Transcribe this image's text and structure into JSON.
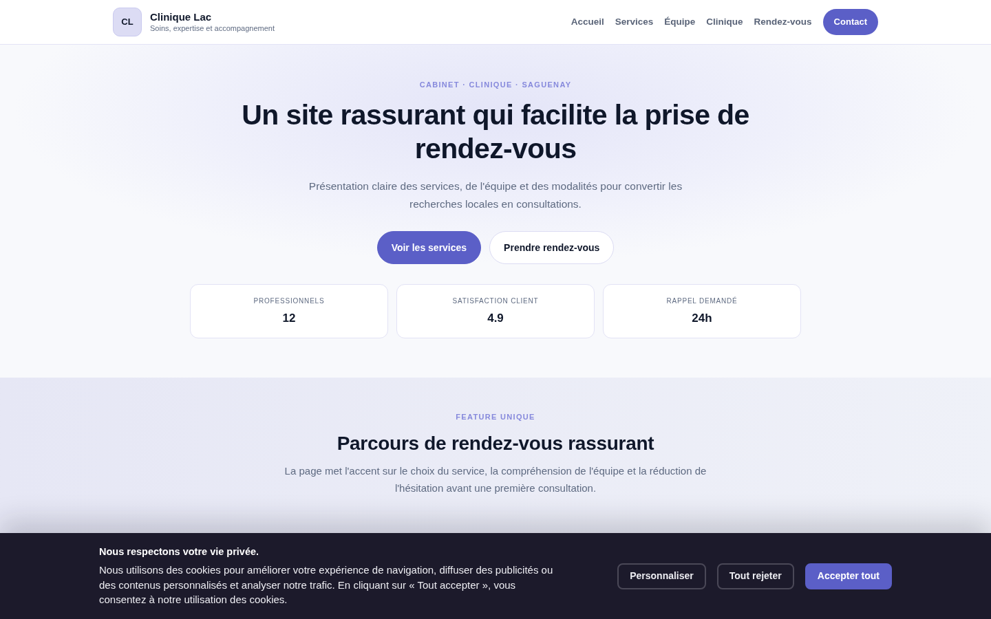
{
  "header": {
    "logo": "CL",
    "brand": "Clinique Lac",
    "tagline": "Soins, expertise et accompagnement",
    "nav": [
      "Accueil",
      "Services",
      "Équipe",
      "Clinique",
      "Rendez-vous"
    ],
    "cta": "Contact"
  },
  "hero": {
    "eyebrow": "CABINET · CLINIQUE · SAGUENAY",
    "title": "Un site rassurant qui facilite la prise de rendez-vous",
    "text": "Présentation claire des services, de l'équipe et des modalités pour convertir les recherches locales en consultations.",
    "buttons": [
      {
        "label": "Voir les services",
        "kind": "primary"
      },
      {
        "label": "Prendre rendez-vous",
        "kind": "secondary"
      }
    ],
    "stats": [
      {
        "label": "PROFESSIONNELS",
        "value": "12"
      },
      {
        "label": "SATISFACTION CLIENT",
        "value": "4.9"
      },
      {
        "label": "RAPPEL DEMANDÉ",
        "value": "24h"
      }
    ]
  },
  "feature": {
    "eyebrow": "FEATURE UNIQUE",
    "title": "Parcours de rendez-vous rassurant",
    "text": "La page met l'accent sur le choix du service, la compréhension de l'équipe et la réduction de l'hésitation avant une première consultation."
  },
  "cookie_banner": {
    "title": "Nous respectons votre vie privée.",
    "text": "Nous utilisons des cookies pour améliorer votre expérience de navigation, diffuser des publicités ou des contenus personnalisés et analyser notre trafic. En cliquant sur « Tout accepter », vous consentez à notre utilisation des cookies.",
    "buttons": [
      {
        "label": "Personnaliser",
        "kind": "outline"
      },
      {
        "label": "Tout rejeter",
        "kind": "outline"
      },
      {
        "label": "Accepter tout",
        "kind": "primary"
      }
    ]
  }
}
